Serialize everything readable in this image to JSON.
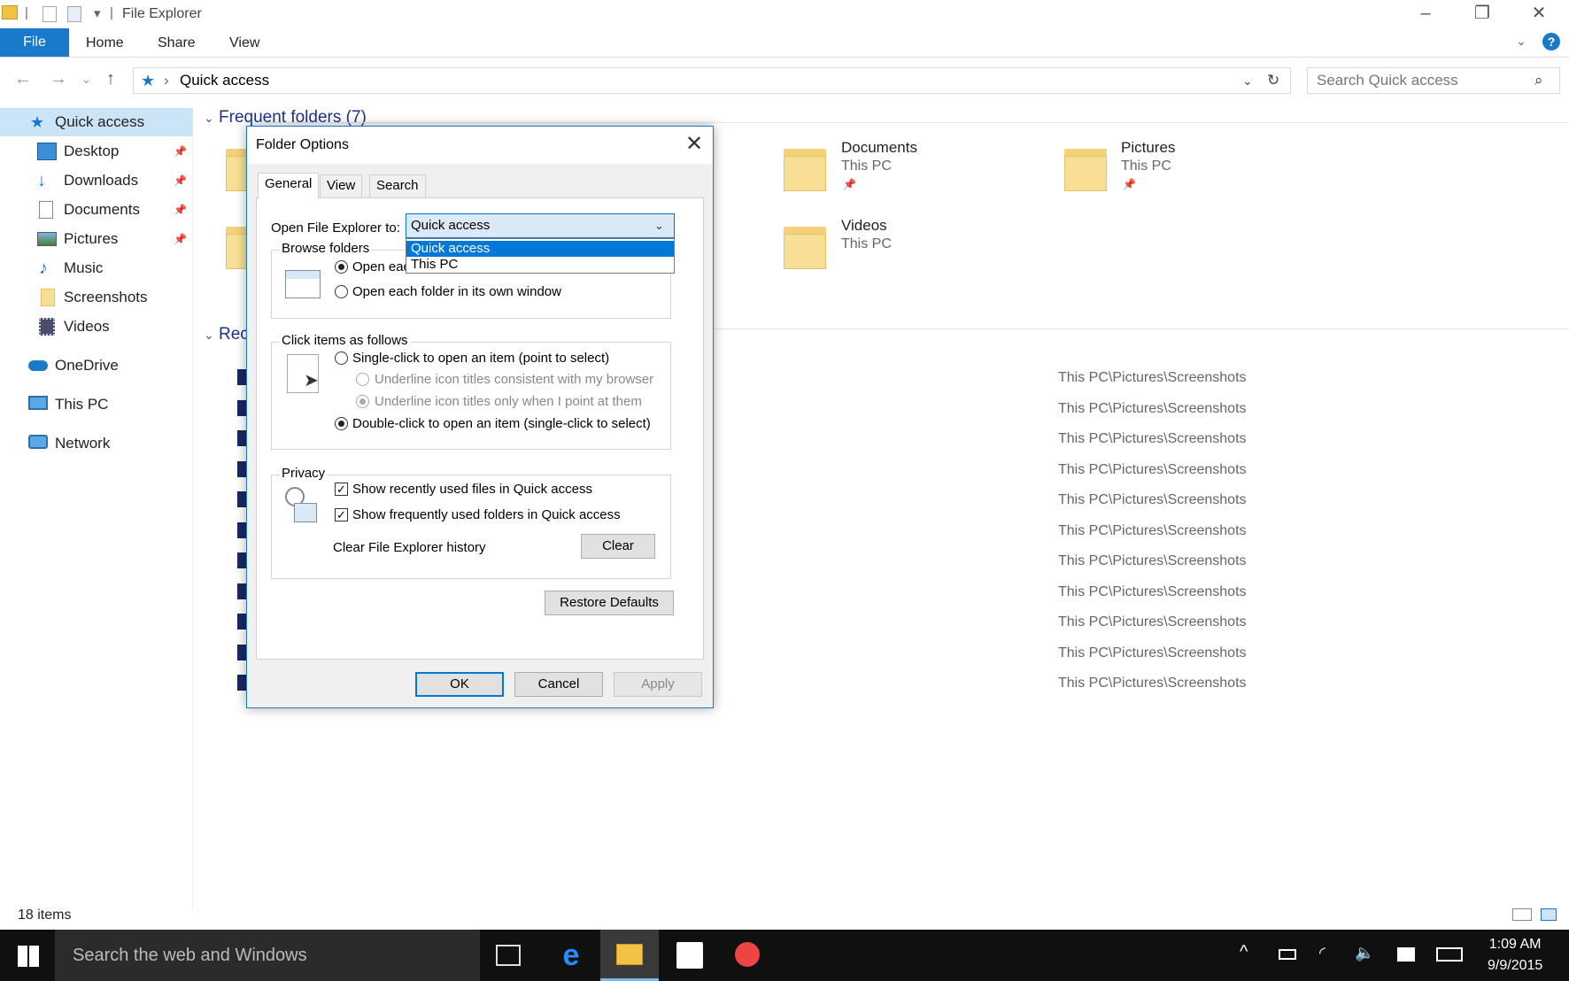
{
  "window": {
    "title": "File Explorer"
  },
  "ribbon": {
    "file": "File",
    "home": "Home",
    "share": "Share",
    "view": "View"
  },
  "address": {
    "path": "Quick access",
    "search_placeholder": "Search Quick access"
  },
  "sidebar": {
    "items": [
      {
        "label": "Quick access",
        "icon": "star-icon",
        "pinned": false
      },
      {
        "label": "Desktop",
        "icon": "desktop-icon",
        "pinned": true
      },
      {
        "label": "Downloads",
        "icon": "download-arrow-icon",
        "pinned": true
      },
      {
        "label": "Documents",
        "icon": "documents-icon",
        "pinned": true
      },
      {
        "label": "Pictures",
        "icon": "pictures-icon",
        "pinned": true
      },
      {
        "label": "Music",
        "icon": "music-note-icon",
        "pinned": false
      },
      {
        "label": "Screenshots",
        "icon": "folder-icon",
        "pinned": false
      },
      {
        "label": "Videos",
        "icon": "videos-icon",
        "pinned": false
      },
      {
        "label": "OneDrive",
        "icon": "cloud-icon",
        "pinned": false
      },
      {
        "label": "This PC",
        "icon": "computer-icon",
        "pinned": false
      },
      {
        "label": "Network",
        "icon": "network-icon",
        "pinned": false
      }
    ]
  },
  "main": {
    "frequent_header": "Frequent folders (7)",
    "recent_header": "Rec",
    "folders": [
      {
        "name": "Documents",
        "location": "This PC"
      },
      {
        "name": "Pictures",
        "location": "This PC"
      },
      {
        "name": "Videos",
        "location": "This PC"
      }
    ],
    "recent_paths": [
      "This PC\\Pictures\\Screenshots",
      "This PC\\Pictures\\Screenshots",
      "This PC\\Pictures\\Screenshots",
      "This PC\\Pictures\\Screenshots",
      "This PC\\Pictures\\Screenshots",
      "This PC\\Pictures\\Screenshots",
      "This PC\\Pictures\\Screenshots",
      "This PC\\Pictures\\Screenshots",
      "This PC\\Pictures\\Screenshots",
      "This PC\\Pictures\\Screenshots",
      "This PC\\Pictures\\Screenshots"
    ]
  },
  "status": {
    "items": "18 items"
  },
  "dialog": {
    "title": "Folder Options",
    "tabs": [
      "General",
      "View",
      "Search"
    ],
    "open_to_label": "Open File Explorer to:",
    "open_to_value": "Quick access",
    "dropdown_options": [
      "Quick access",
      "This PC"
    ],
    "browse_group": "Browse folders",
    "browse_same": "Open each folder in the same window",
    "browse_own": "Open each folder in its own window",
    "click_group": "Click items as follows",
    "single_click": "Single-click to open an item (point to select)",
    "underline_browser": "Underline icon titles consistent with my browser",
    "underline_point": "Underline icon titles only when I point at them",
    "double_click": "Double-click to open an item (single-click to select)",
    "privacy_group": "Privacy",
    "show_recent": "Show recently used files in Quick access",
    "show_frequent": "Show frequently used folders in Quick access",
    "clear_history_label": "Clear File Explorer history",
    "clear_button": "Clear",
    "restore_button": "Restore Defaults",
    "ok": "OK",
    "cancel": "Cancel",
    "apply": "Apply"
  },
  "taskbar": {
    "search": "Search the web and Windows",
    "time": "1:09 AM",
    "date": "9/9/2015"
  },
  "colors": {
    "accent": "#1979ca",
    "folder": "#f3d27a",
    "taskbar": "#101010"
  }
}
